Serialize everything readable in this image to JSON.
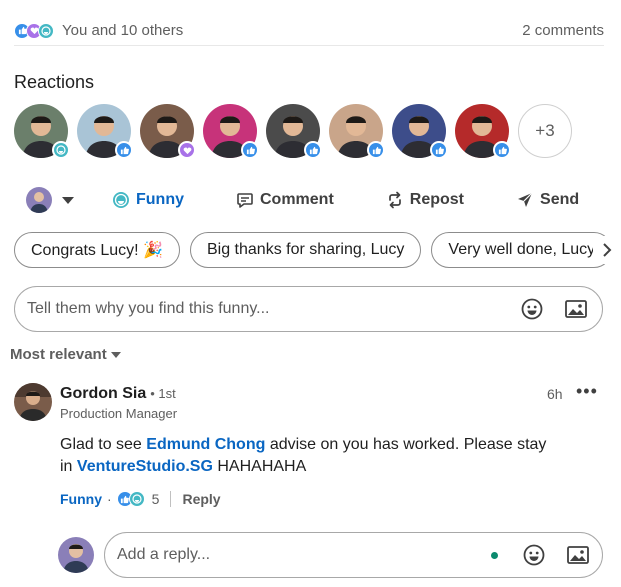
{
  "colors": {
    "accent": "#0a66c2",
    "like": "#378fe9",
    "support": "#a872e8",
    "funny": "#44b8c4",
    "text_secondary": "#5e5e5e"
  },
  "stats": {
    "reactions_text": "You and 10 others",
    "comments_text": "2 comments",
    "reaction_icons": [
      "like-icon",
      "support-icon",
      "funny-icon"
    ]
  },
  "reactions_panel": {
    "title": "Reactions",
    "people": [
      {
        "badge": "funny",
        "tint": "#6b7f6b"
      },
      {
        "badge": "like",
        "tint": "#a9c4d6"
      },
      {
        "badge": "support",
        "tint": "#7a5c4a"
      },
      {
        "badge": "like",
        "tint": "#c7337a"
      },
      {
        "badge": "like",
        "tint": "#4b4b4b"
      },
      {
        "badge": "like",
        "tint": "#c9a58a"
      },
      {
        "badge": "like",
        "tint": "#3d4d8a"
      },
      {
        "badge": "like",
        "tint": "#b52a2a"
      }
    ],
    "more_label": "+3"
  },
  "actions": {
    "funny_label": "Funny",
    "comment_label": "Comment",
    "repost_label": "Repost",
    "send_label": "Send"
  },
  "suggestions": [
    "Congrats Lucy! 🎉",
    "Big thanks for sharing, Lucy",
    "Very well done, Lucy"
  ],
  "comment_input": {
    "placeholder": "Tell them why you find this funny..."
  },
  "sort": {
    "label": "Most relevant"
  },
  "comment": {
    "author": "Gordon Sia",
    "degree": "• 1st",
    "headline": "Production Manager",
    "time": "6h",
    "text_part1": "Glad to see ",
    "mention1": "Edmund Chong",
    "text_part2": " advise on you has worked. Please stay in ",
    "mention2": "VentureStudio.SG",
    "text_part3": " HAHAHAHA",
    "reaction_label": "Funny",
    "reaction_count": "5",
    "reply_label": "Reply"
  },
  "reply_input": {
    "placeholder": "Add a reply..."
  }
}
